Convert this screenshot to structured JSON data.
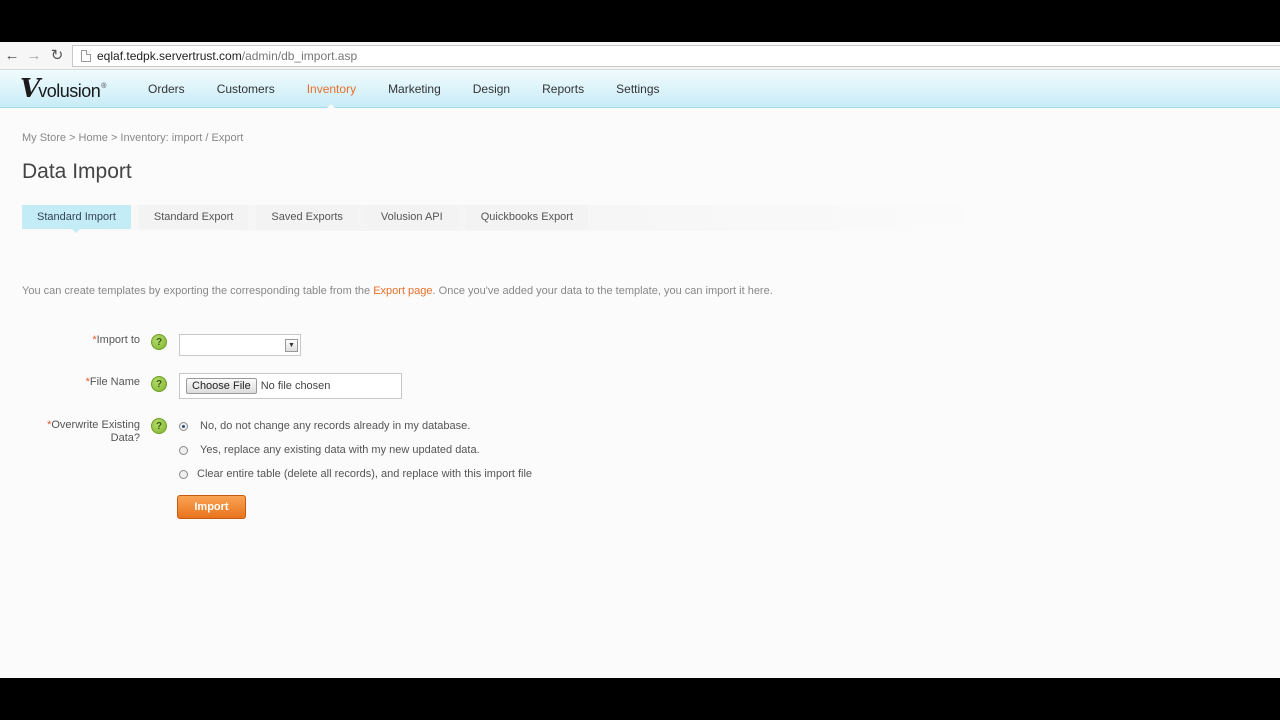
{
  "browser": {
    "url_host": "eqlaf.tedpk.servertrust.com",
    "url_path": "/admin/db_import.asp",
    "icons": {
      "back": "back-arrow-icon",
      "forward": "forward-arrow-icon",
      "reload": "reload-icon"
    }
  },
  "header": {
    "logo_v": "V",
    "logo_text": "volusion",
    "logo_reg": "®",
    "nav": [
      "Orders",
      "Customers",
      "Inventory",
      "Marketing",
      "Design",
      "Reports",
      "Settings"
    ],
    "active_nav": "Inventory",
    "accent_color": "#e8702a"
  },
  "breadcrumb": "My Store > Home > Inventory: import / Export",
  "page_title": "Data Import",
  "tabs": [
    "Standard Import",
    "Standard Export",
    "Saved Exports",
    "Volusion API",
    "Quickbooks Export"
  ],
  "intro": {
    "before": "You can create templates by exporting the corresponding table from the ",
    "link": "Export page",
    "after": ". Once you've added your data to the template, you can import it here."
  },
  "form": {
    "required_mark": "*",
    "help_mark": "?",
    "import_to_label": "Import to",
    "import_to_value": "",
    "file_name_label": "File Name",
    "choose_file": "Choose File",
    "file_status": "No file chosen",
    "overwrite_label_1": "Overwrite Existing",
    "overwrite_label_2": "Data?",
    "options": [
      "No, do not change any records already in my database.",
      "Yes, replace any existing data with my new updated data.",
      "Clear entire table (delete all records), and replace with this import file"
    ],
    "selected_option": 0,
    "import_button": "Import"
  }
}
